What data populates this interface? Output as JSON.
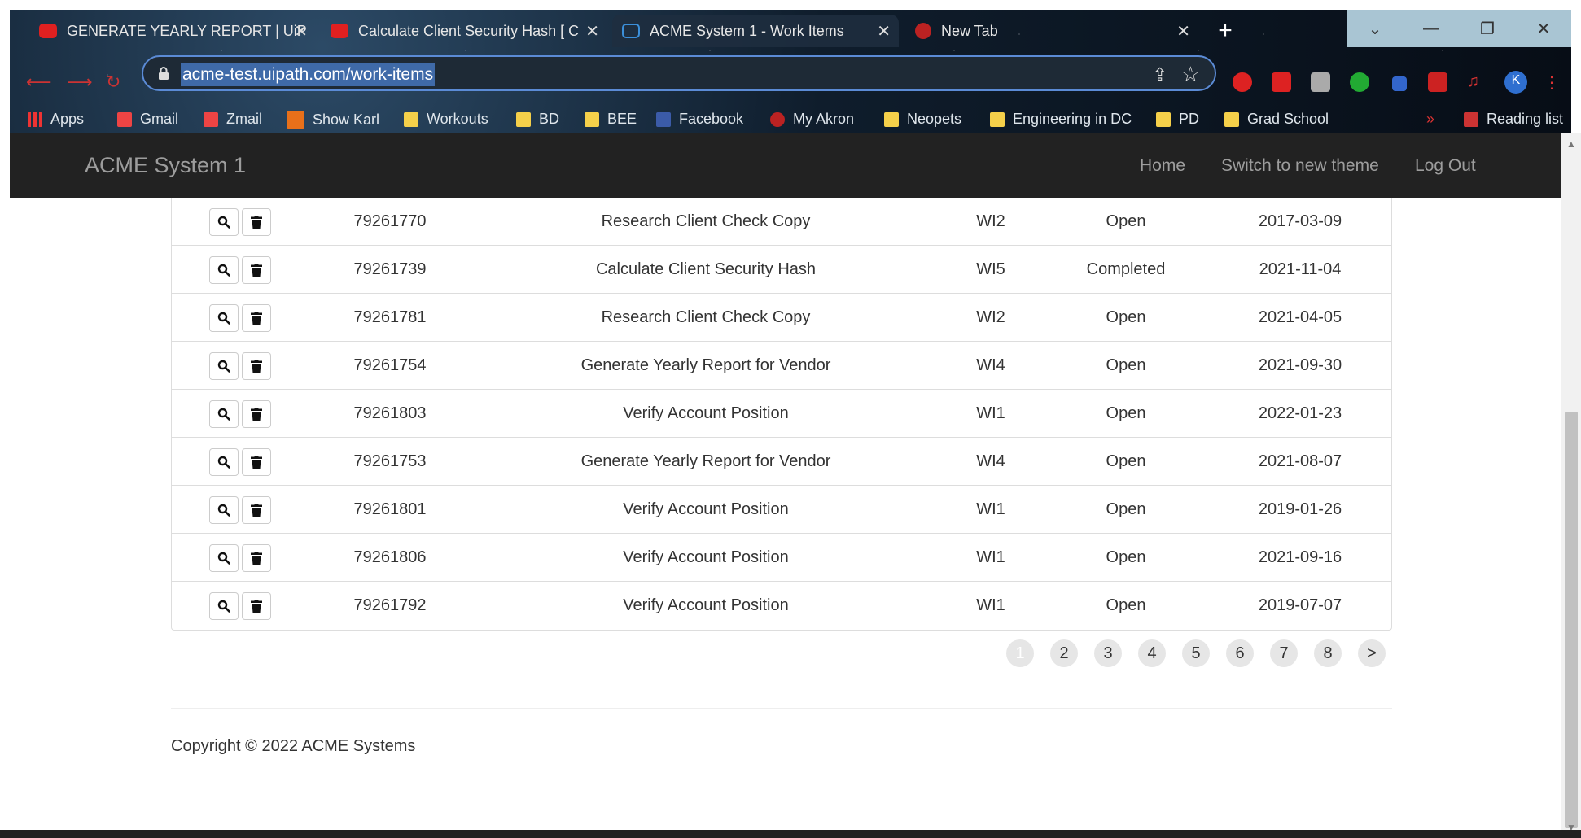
{
  "browser": {
    "tabs": [
      {
        "title": "GENERATE YEARLY REPORT | UiP",
        "icon": "youtube-icon"
      },
      {
        "title": "Calculate Client Security Hash [ C",
        "icon": "youtube-icon"
      },
      {
        "title": "ACME System 1 - Work Items",
        "icon": "uipath-icon"
      },
      {
        "title": "New Tab",
        "icon": "new-tab-icon"
      }
    ],
    "url": "acme-test.uipath.com/work-items",
    "profile_initial": "K",
    "bookmarks": [
      {
        "label": "Apps"
      },
      {
        "label": "Gmail"
      },
      {
        "label": "Zmail"
      },
      {
        "label": "Show Karl"
      },
      {
        "label": "Workouts"
      },
      {
        "label": "BD"
      },
      {
        "label": "BEE"
      },
      {
        "label": "Facebook"
      },
      {
        "label": "My Akron"
      },
      {
        "label": "Neopets"
      },
      {
        "label": "Engineering in DC"
      },
      {
        "label": "PD"
      },
      {
        "label": "Grad School"
      }
    ],
    "reading_list": "Reading list",
    "more_bookmarks": "»"
  },
  "navbar": {
    "brand": "ACME System 1",
    "links": [
      "Home",
      "Switch to new theme",
      "Log Out"
    ]
  },
  "work_items": [
    {
      "id": "79261770",
      "description": "Research Client Check Copy",
      "type": "WI2",
      "status": "Open",
      "date": "2017-03-09"
    },
    {
      "id": "79261739",
      "description": "Calculate Client Security Hash",
      "type": "WI5",
      "status": "Completed",
      "date": "2021-11-04"
    },
    {
      "id": "79261781",
      "description": "Research Client Check Copy",
      "type": "WI2",
      "status": "Open",
      "date": "2021-04-05"
    },
    {
      "id": "79261754",
      "description": "Generate Yearly Report for Vendor",
      "type": "WI4",
      "status": "Open",
      "date": "2021-09-30"
    },
    {
      "id": "79261803",
      "description": "Verify Account Position",
      "type": "WI1",
      "status": "Open",
      "date": "2022-01-23"
    },
    {
      "id": "79261753",
      "description": "Generate Yearly Report for Vendor",
      "type": "WI4",
      "status": "Open",
      "date": "2021-08-07"
    },
    {
      "id": "79261801",
      "description": "Verify Account Position",
      "type": "WI1",
      "status": "Open",
      "date": "2019-01-26"
    },
    {
      "id": "79261806",
      "description": "Verify Account Position",
      "type": "WI1",
      "status": "Open",
      "date": "2021-09-16"
    },
    {
      "id": "79261792",
      "description": "Verify Account Position",
      "type": "WI1",
      "status": "Open",
      "date": "2019-07-07"
    }
  ],
  "pagination": {
    "pages": [
      "1",
      "2",
      "3",
      "4",
      "5",
      "6",
      "7",
      "8"
    ],
    "current": "1",
    "next": ">"
  },
  "footer": {
    "copyright": "Copyright © 2022 ACME Systems"
  },
  "colors": {
    "navbar_bg": "#222222",
    "navbar_text": "#9d9d9d",
    "url_highlight": "#3f6aa8",
    "omnibox_border": "#5b8bd6"
  }
}
